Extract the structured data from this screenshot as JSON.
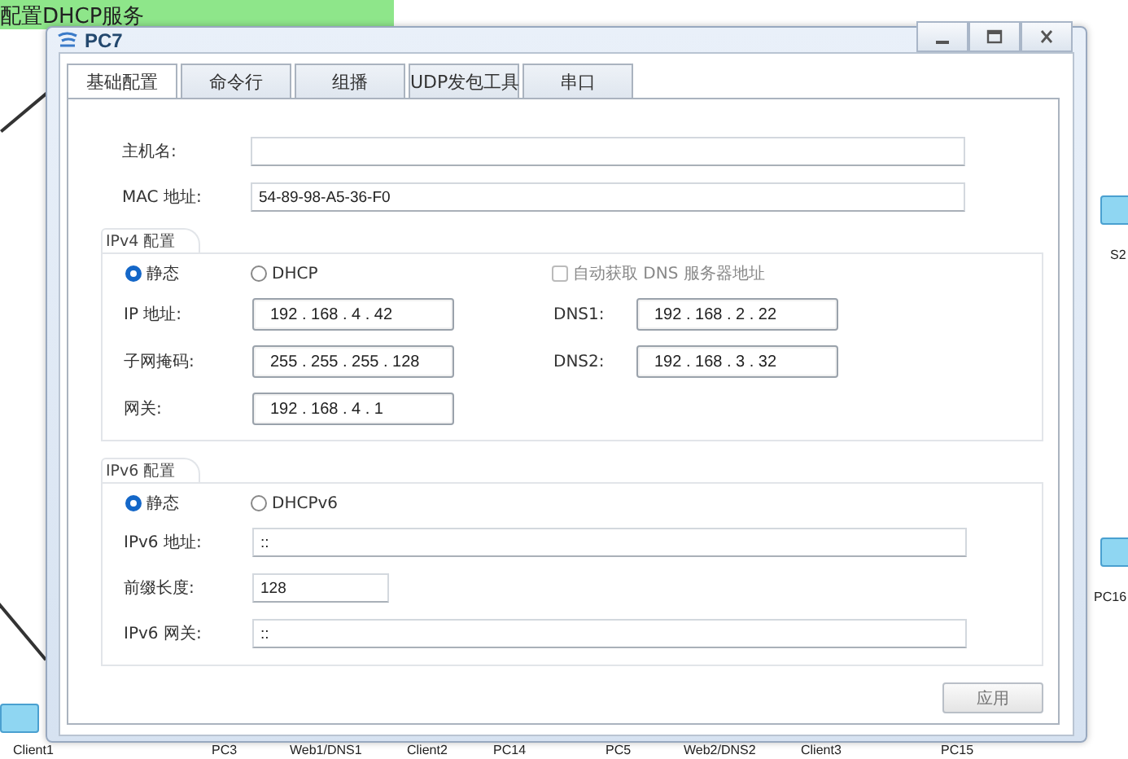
{
  "canvas": {
    "note": "配置DHCP服务",
    "devices": [
      {
        "label": "Client1"
      },
      {
        "label": "PC3"
      },
      {
        "label": "Web1/DNS1"
      },
      {
        "label": "Client2"
      },
      {
        "label": "PC14"
      },
      {
        "label": "PC5"
      },
      {
        "label": "Web2/DNS2"
      },
      {
        "label": "Client3"
      },
      {
        "label": "PC15"
      }
    ],
    "side_devices": [
      {
        "label": "S2"
      },
      {
        "label": "PC16"
      }
    ]
  },
  "window": {
    "title": "PC7",
    "tabs": [
      {
        "label": "基础配置",
        "selected": true
      },
      {
        "label": "命令行",
        "selected": false
      },
      {
        "label": "组播",
        "selected": false
      },
      {
        "label": "UDP发包工具",
        "selected": false
      },
      {
        "label": "串口",
        "selected": false
      }
    ],
    "hostname": {
      "label": "主机名:"
    },
    "mac": {
      "label": "MAC 地址:",
      "value": "54-89-98-A5-36-F0"
    },
    "ipv4": {
      "title": "IPv4 配置",
      "modes": [
        {
          "label": "静态",
          "selected": true
        },
        {
          "label": "DHCP",
          "selected": false
        }
      ],
      "auto_dns": {
        "label": "自动获取 DNS 服务器地址",
        "checked": false,
        "disabled": true
      },
      "fields": [
        {
          "label": "IP 地址:",
          "value": "192 . 168 . 4 . 42"
        },
        {
          "label": "子网掩码:",
          "value": "255 . 255 . 255 . 128"
        },
        {
          "label": "网关:",
          "value": "192 . 168 . 4 . 1"
        }
      ],
      "dns": [
        {
          "label": "DNS1:",
          "value": "192 . 168 . 2 . 22"
        },
        {
          "label": "DNS2:",
          "value": "192 . 168 . 3 . 32"
        }
      ]
    },
    "ipv6": {
      "title": "IPv6 配置",
      "modes": [
        {
          "label": "静态",
          "selected": true
        },
        {
          "label": "DHCPv6",
          "selected": false
        }
      ],
      "fields": [
        {
          "label": "IPv6 地址:",
          "value": "::",
          "kind": "wide"
        },
        {
          "label": "前缀长度:",
          "value": "128",
          "kind": "short"
        },
        {
          "label": "IPv6 网关:",
          "value": "::",
          "kind": "wide"
        }
      ]
    },
    "apply_button": "应用"
  }
}
